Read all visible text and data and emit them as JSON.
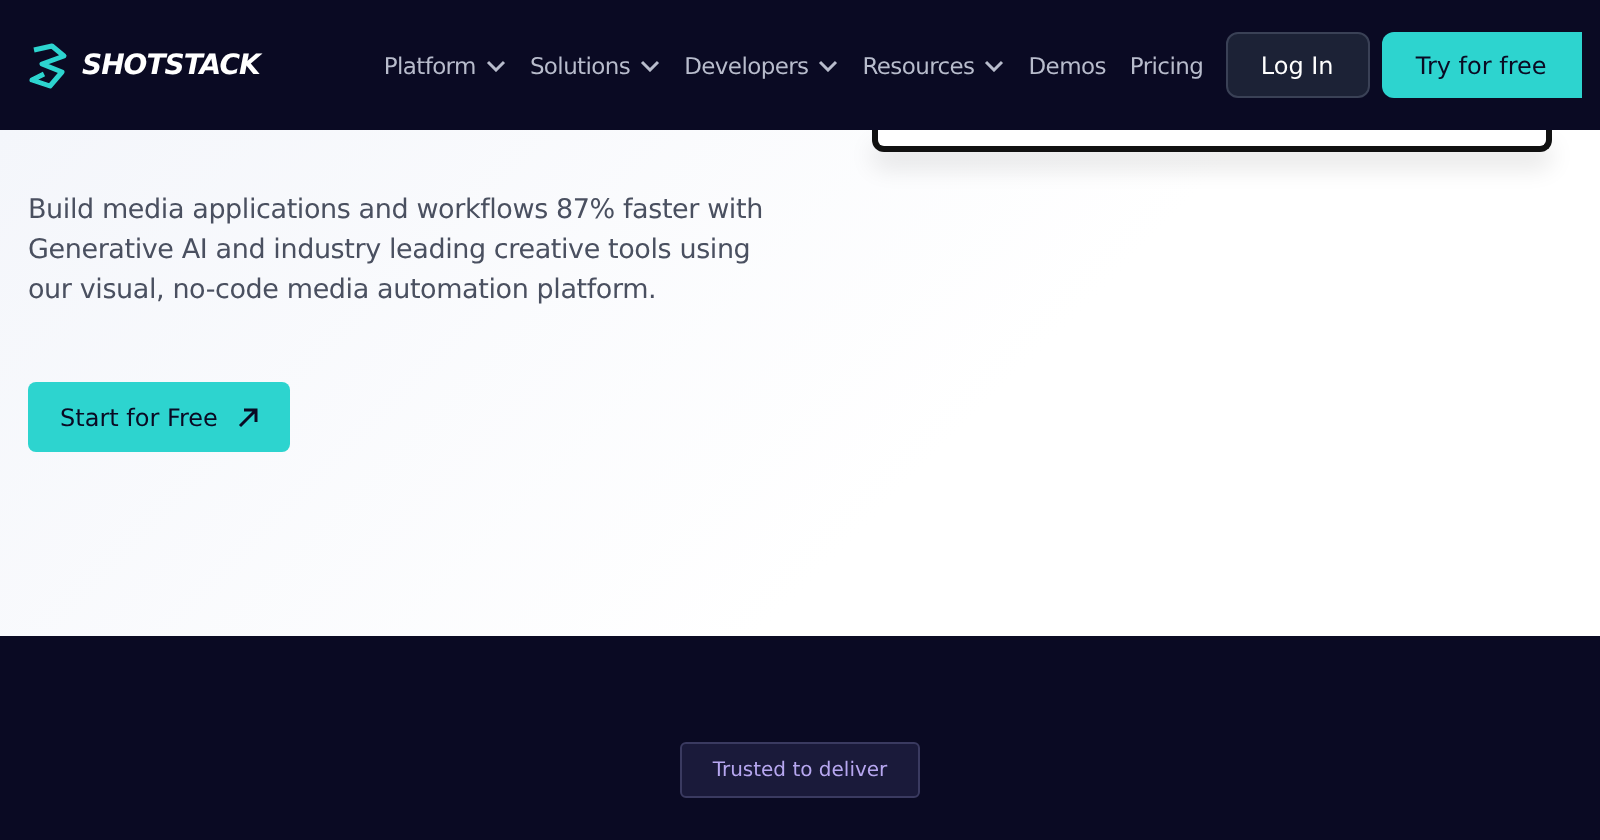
{
  "nav": {
    "logo": "SHOTSTACK",
    "links": [
      {
        "label": "Platform",
        "dropdown": true
      },
      {
        "label": "Solutions",
        "dropdown": true
      },
      {
        "label": "Developers",
        "dropdown": true
      },
      {
        "label": "Resources",
        "dropdown": true
      },
      {
        "label": "Demos",
        "dropdown": false
      },
      {
        "label": "Pricing",
        "dropdown": false
      }
    ],
    "login": "Log In",
    "cta": "Try for free"
  },
  "hero": {
    "description": "Build media applications and workflows 87% faster with Generative AI and industry leading creative tools using our visual, no-code media automation platform.",
    "button": "Start for Free"
  },
  "trust": {
    "badge": "Trusted to deliver"
  }
}
